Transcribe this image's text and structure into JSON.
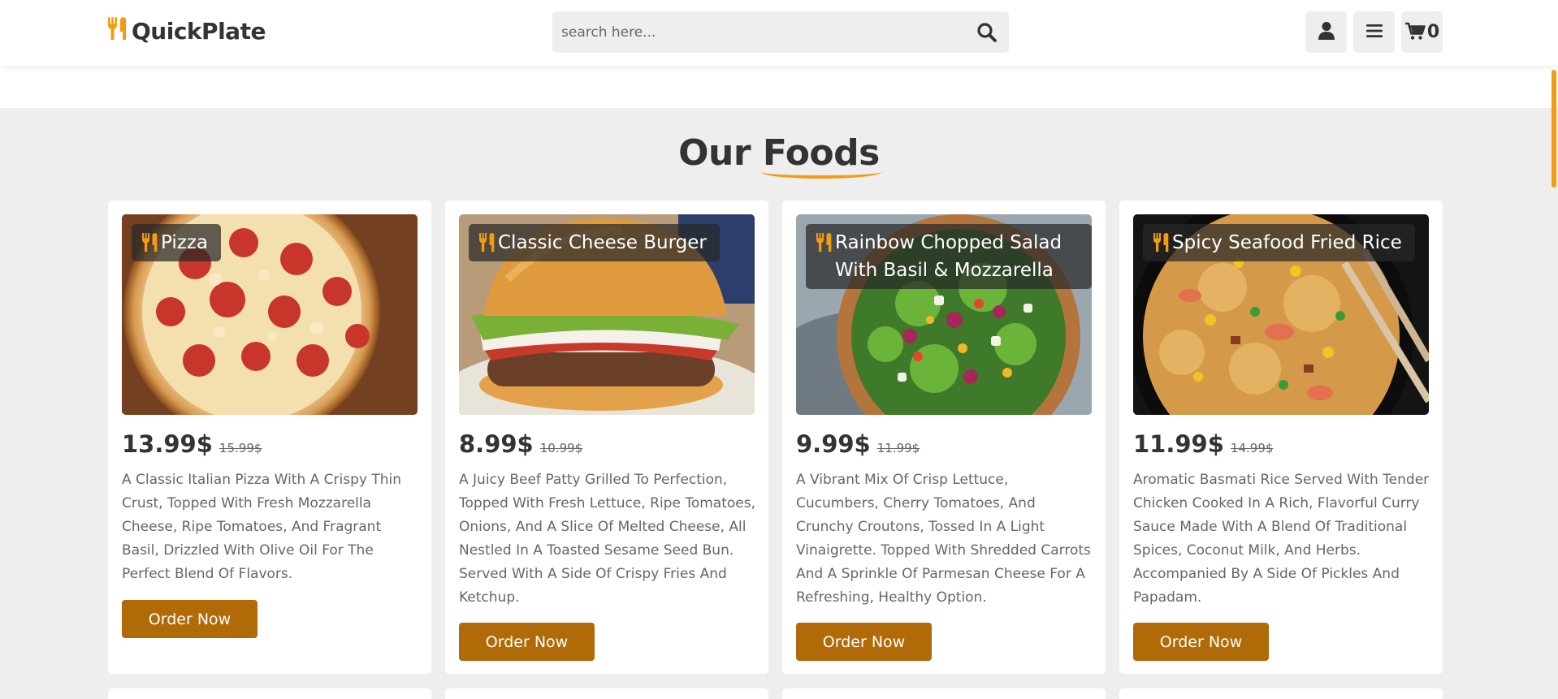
{
  "header": {
    "logo_text": "QuickPlate",
    "search": {
      "placeholder": "search here..."
    },
    "cart_count": "0"
  },
  "section": {
    "title_part1": "Our",
    "title_part2": "Foods"
  },
  "foods": [
    {
      "name": "Pizza",
      "price": "13.99$",
      "old_price": "15.99$",
      "description": "A Classic Italian Pizza With A Crispy Thin Crust, Topped With Fresh Mozzarella Cheese, Ripe Tomatoes, And Fragrant Basil, Drizzled With Olive Oil For The Perfect Blend Of Flavors.",
      "button": "Order Now"
    },
    {
      "name": "Classic Cheese Burger",
      "price": "8.99$",
      "old_price": "10.99$",
      "description": "A Juicy Beef Patty Grilled To Perfection, Topped With Fresh Lettuce, Ripe Tomatoes, Onions, And A Slice Of Melted Cheese, All Nestled In A Toasted Sesame Seed Bun. Served With A Side Of Crispy Fries And Ketchup.",
      "button": "Order Now"
    },
    {
      "name": "Rainbow Chopped Salad With Basil & Mozzarella",
      "price": "9.99$",
      "old_price": "11.99$",
      "description": "A Vibrant Mix Of Crisp Lettuce, Cucumbers, Cherry Tomatoes, And Crunchy Croutons, Tossed In A Light Vinaigrette. Topped With Shredded Carrots And A Sprinkle Of Parmesan Cheese For A Refreshing, Healthy Option.",
      "button": "Order Now"
    },
    {
      "name": "Spicy Seafood Fried Rice",
      "price": "11.99$",
      "old_price": "14.99$",
      "description": "Aromatic Basmati Rice Served With Tender Chicken Cooked In A Rich, Flavorful Curry Sauce Made With A Blend Of Traditional Spices, Coconut Milk, And Herbs. Accompanied By A Side Of Pickles And Papadam.",
      "button": "Order Now"
    }
  ],
  "colors": {
    "accent": "#f39c12",
    "button": "#b06b08",
    "text_dark": "#333333",
    "text_light": "#666666",
    "background": "#eeeeee"
  },
  "icons": [
    "utensils-icon",
    "search-icon",
    "user-icon",
    "bars-icon",
    "cart-icon"
  ]
}
